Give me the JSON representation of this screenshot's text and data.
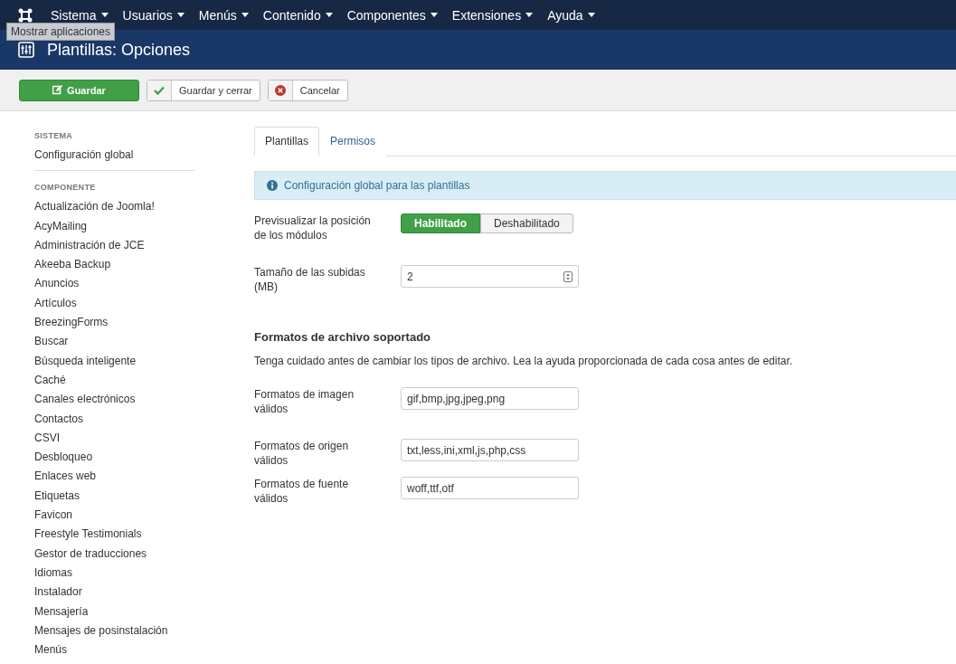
{
  "topbar": {
    "menus": [
      {
        "label": "Sistema"
      },
      {
        "label": "Usuarios"
      },
      {
        "label": "Menús"
      },
      {
        "label": "Contenido"
      },
      {
        "label": "Componentes"
      },
      {
        "label": "Extensiones"
      },
      {
        "label": "Ayuda"
      }
    ],
    "tooltip": "Mostrar aplicaciones"
  },
  "header": {
    "title": "Plantillas: Opciones"
  },
  "toolbar": [
    {
      "kind": "primary",
      "label": "Guardar"
    },
    {
      "kind": "check",
      "label": "Guardar y cerrar"
    },
    {
      "kind": "cancel",
      "label": "Cancelar"
    }
  ],
  "sidebar": {
    "sections": [
      {
        "heading": "SISTEMA",
        "items": [
          "Configuración global"
        ]
      },
      {
        "heading": "COMPONENTE",
        "items": [
          "Actualización de Joomla!",
          "AcyMailing",
          "Administración de JCE",
          "Akeeba Backup",
          "Anuncios",
          "Artículos",
          "BreezingForms",
          "Buscar",
          "Búsqueda inteligente",
          "Caché",
          "Canales electrónicos",
          "Contactos",
          "CSVI",
          "Desbloqueo",
          "Enlaces web",
          "Etiquetas",
          "Favicon",
          "Freestyle Testimonials",
          "Gestor de traducciones",
          "Idiomas",
          "Instalador",
          "Mensajería",
          "Mensajes de posinstalación",
          "Menús"
        ]
      }
    ]
  },
  "tabs": [
    {
      "label": "Plantillas",
      "selected": true
    },
    {
      "label": "Permisos",
      "selected": false
    }
  ],
  "info": "Configuración global para las plantillas",
  "fields": [
    {
      "kind": "toggle",
      "label": "Previsualizar la posición de los módulos",
      "options": [
        {
          "label": "Habilitado",
          "selected": true
        },
        {
          "label": "Deshabilitado",
          "selected": false
        }
      ]
    },
    {
      "kind": "number",
      "label": "Tamaño de las subidas (MB)",
      "value": "2"
    }
  ],
  "formats": {
    "heading": "Formatos de archivo soportado",
    "note": "Tenga cuidado antes de cambiar los tipos de archivo. Lea la ayuda proporcionada de cada cosa antes de editar.",
    "fields": [
      {
        "label": "Formatos de imagen válidos",
        "value": "gif,bmp,jpg,jpeg,png"
      },
      {
        "label": "Formatos de origen válidos",
        "value": "txt,less,ini,xml,js,php,css"
      },
      {
        "label": "Formatos de fuente válidos",
        "value": "woff,ttf,otf"
      }
    ]
  }
}
